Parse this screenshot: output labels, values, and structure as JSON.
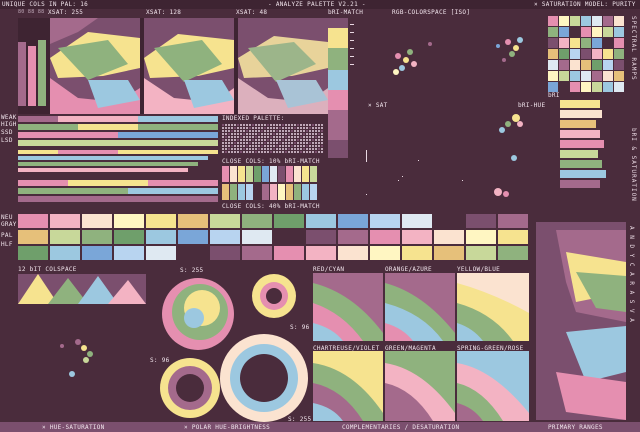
{
  "header": {
    "unique_cols": "UNIQUE COLS IN PAL: 16",
    "numbers": "80 88 88",
    "xsat_255": "XSAT: 255",
    "xsat_128": "XSAT: 128",
    "xsat_48": "XSAT: 48",
    "title": "- ANALYZE PALETTE V2.21 -",
    "rgb_colorspace": "RGB-COLORSPACE [ISO]",
    "saturation_model": "× SATURATION MODEL: PURITY"
  },
  "left_labels": {
    "weak": "WEAK",
    "high": "HIGH",
    "ssd": "SSD",
    "lsd": "LSD",
    "neu": "NEU",
    "gray": "GRAY",
    "pal": "PAL",
    "hlf": "HLF"
  },
  "labels": {
    "indexed_palette": "INDEXED PALETTE:",
    "close_10": "CLOSE COLS: 10% bRI-MATCH",
    "close_40": "CLOSE COLS: 40% bRI-MATCH",
    "bri_match": "bRI-MATCH",
    "x_sat": "× SAT",
    "bri_hue": "bRI-HUE",
    "bri": "bRI",
    "colspace_12bit": "12 bIT COLSPACE",
    "s255_a": "S: 255",
    "s96_a": "S: 96",
    "s96_b": "S: 96",
    "s255_b": "S: 255"
  },
  "sections": {
    "red_cyan": "RED/CYAN",
    "orange_azure": "ORANGE/AZURE",
    "yellow_blue": "YELLOW/BLUE",
    "chartreuse_violet": "CHARTREUSE/VIOLET",
    "green_magenta": "GREEN/MAGENTA",
    "spring_green_rose": "SPRING-GREEN/ROSE"
  },
  "vertical_labels": {
    "spectral_ramps": "SPECTRAL RAMPS",
    "bri_saturation": "bRI & SATURATION",
    "right_letters": "A N D Y C A R A S V A"
  },
  "footer": {
    "hue_saturation": "× HUE-SATURATION",
    "polar": "× POLAR HUE-BRIGHTNESS",
    "complementaries": "COMPLEMENTARIES / DESATURATION",
    "primary_ranges": "PRIMARY RANGES"
  },
  "palette": [
    "#4a2c3c",
    "#7b4f6e",
    "#a46a8c",
    "#e58fb0",
    "#f3b3c3",
    "#fbe3d0",
    "#fff6c2",
    "#f6e38f",
    "#e6c07a",
    "#c8d89a",
    "#8fb27e",
    "#6f9f6b",
    "#9cc8e0",
    "#7aa6d8",
    "#b8d4f0",
    "#dfe9f2"
  ],
  "colors": {
    "background": "#4a2c3c",
    "bar": "#7b4f6e",
    "dark": "#3e2432"
  }
}
